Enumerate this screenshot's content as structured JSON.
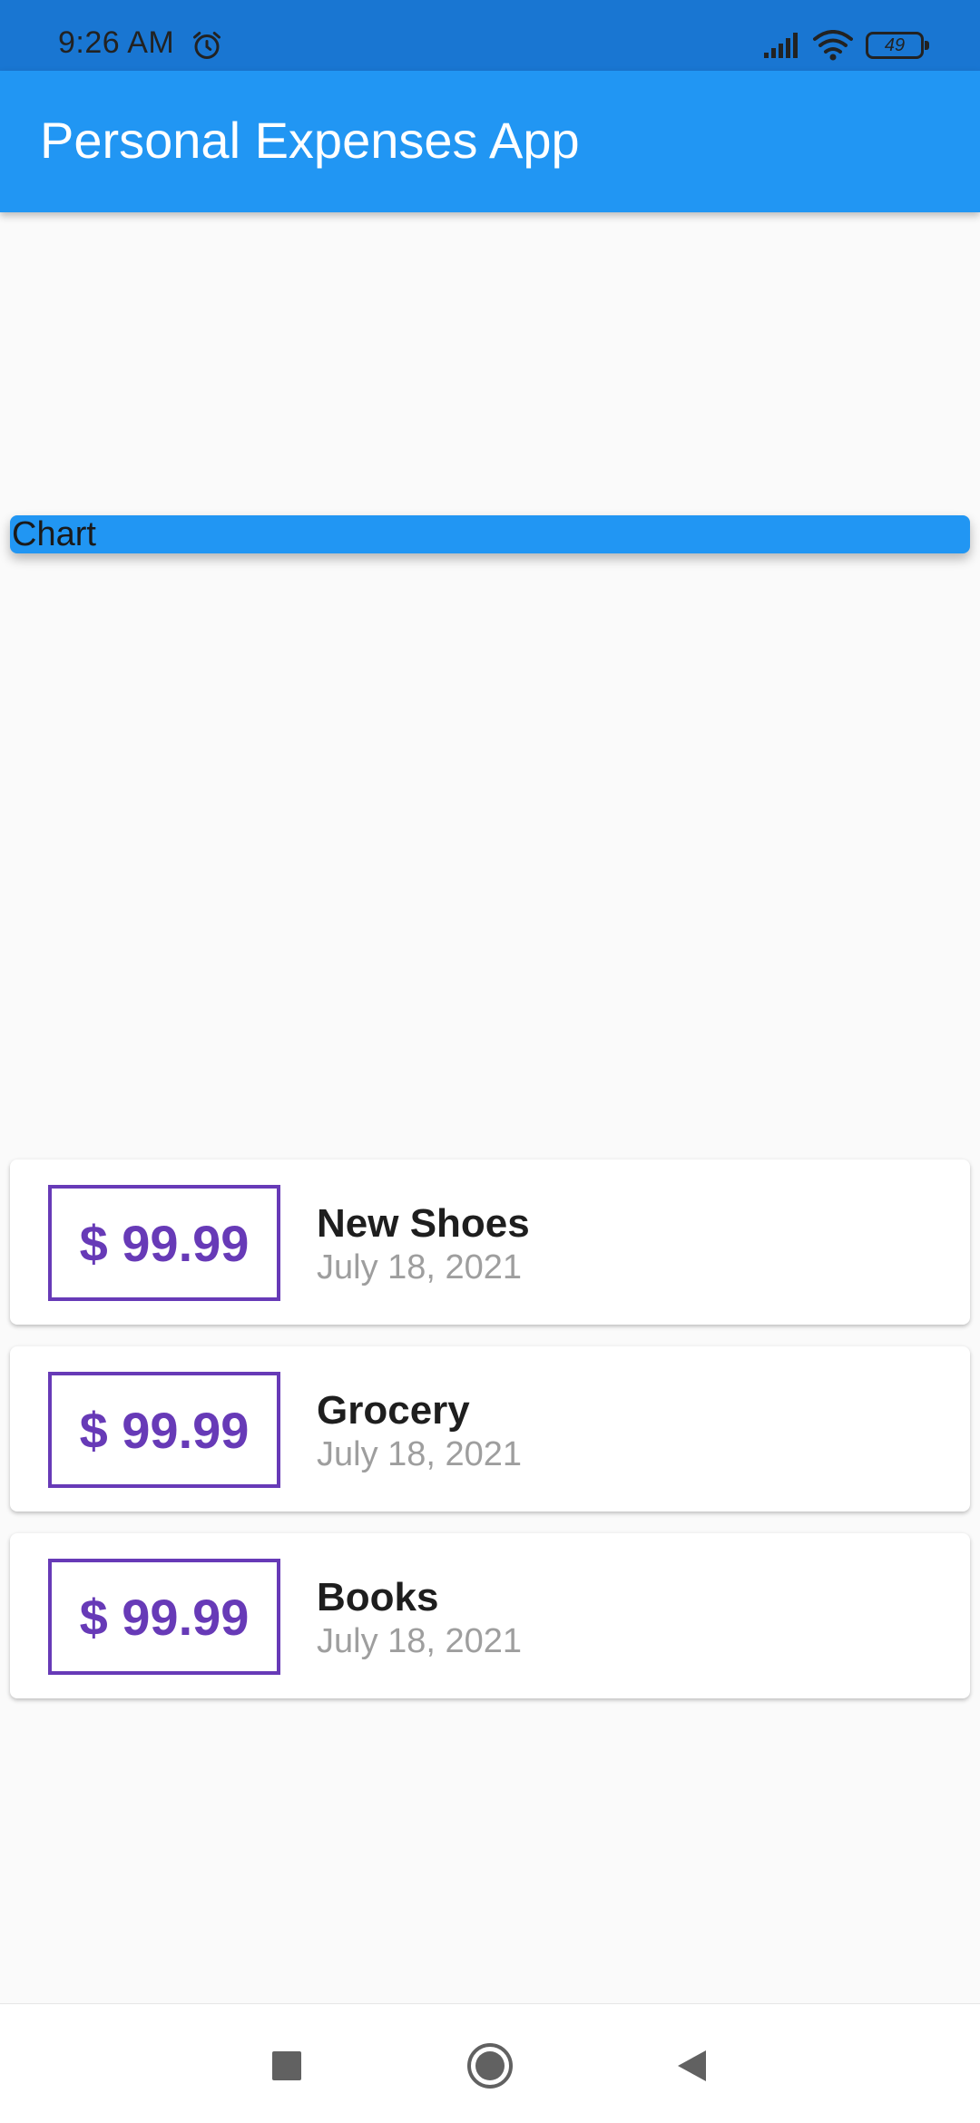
{
  "status_bar": {
    "time": "9:26 AM",
    "battery": "49",
    "icons": [
      "alarm-icon",
      "signal-icon",
      "wifi-icon",
      "battery-icon"
    ]
  },
  "app_bar": {
    "title": "Personal Expenses App"
  },
  "chart": {
    "label": "Chart"
  },
  "transactions": [
    {
      "amount": "$ 99.99",
      "title": "New Shoes",
      "date": "July 18, 2021"
    },
    {
      "amount": "$ 99.99",
      "title": "Grocery",
      "date": "July 18, 2021"
    },
    {
      "amount": "$ 99.99",
      "title": "Books",
      "date": "July 18, 2021"
    }
  ],
  "nav_bar": {
    "icons": [
      "recents-icon",
      "home-icon",
      "back-icon"
    ]
  },
  "colors": {
    "status_bar": "#1976d2",
    "app_bar": "#2196f3",
    "amount_accent": "#673ab7",
    "background": "#fafafa"
  }
}
